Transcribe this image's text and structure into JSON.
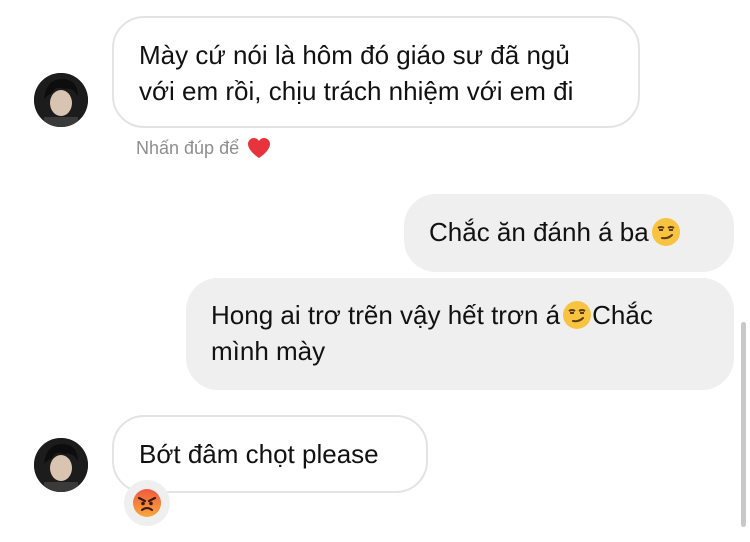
{
  "messages": {
    "m1": {
      "line1": "Mày cứ nói là hôm đó giáo sư đã ngủ",
      "line2": "với em rồi, chịu trách nhiệm với em đi"
    },
    "double_tap_hint": "Nhấn đúp để",
    "m2": {
      "text": "Chắc ăn đánh á ba"
    },
    "m3": {
      "line1_text": "Hong ai trơ trẽn vậy hết trơn á",
      "line1_after": "Chắc",
      "line2": "mình mày"
    },
    "m4": {
      "text": "Bớt đâm chọt please"
    }
  },
  "icons": {
    "like_hint": "red-heart-icon",
    "smirk": "smirking-face-emoji",
    "reaction": "angry-face-emoji"
  },
  "colors": {
    "incoming_border": "#e3e3e3",
    "outgoing_bg": "#efefef",
    "hint_text": "#8e8e8e",
    "heart": "#e8323c",
    "emoji_yellow": "#f7c340",
    "angry_red": "#ef4d3c"
  }
}
